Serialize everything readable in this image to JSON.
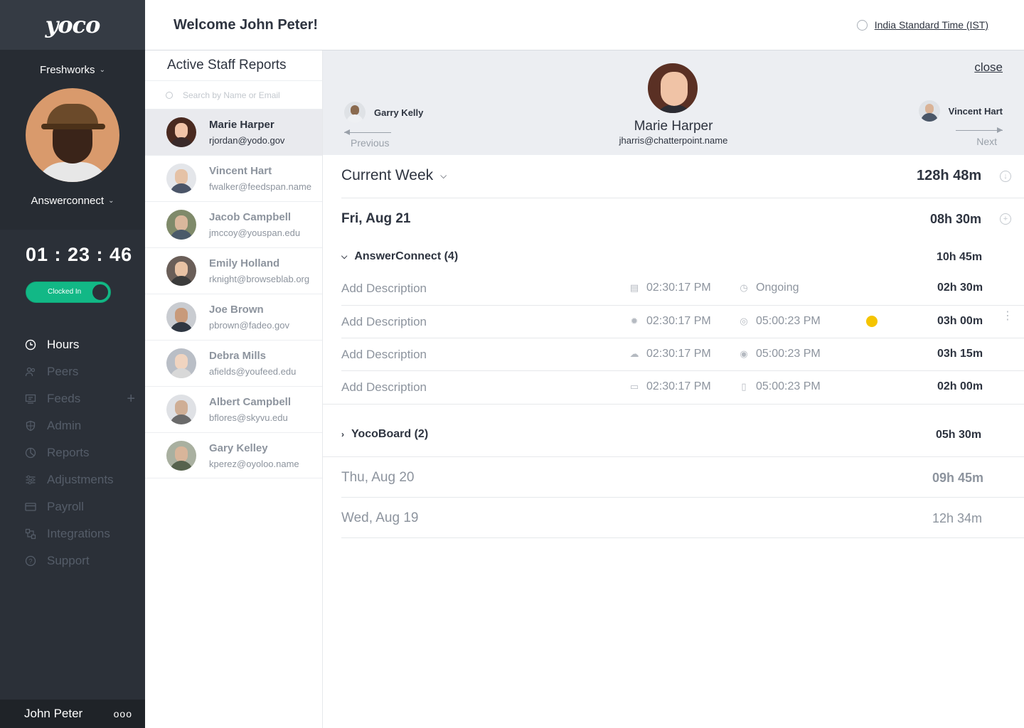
{
  "app": {
    "logo": "yoco"
  },
  "sidebar": {
    "company": "Freshworks",
    "workspace": "Answerconnect",
    "timer": "01 : 23 : 46",
    "toggle_label": "Clocked In",
    "nav": [
      {
        "label": "Hours",
        "icon": "clock-icon",
        "active": true
      },
      {
        "label": "Peers",
        "icon": "people-icon"
      },
      {
        "label": "Feeds",
        "icon": "feed-icon"
      },
      {
        "label": "Admin",
        "icon": "shield-icon"
      },
      {
        "label": "Reports",
        "icon": "pie-chart-icon"
      },
      {
        "label": "Adjustments",
        "icon": "sliders-icon"
      },
      {
        "label": "Payroll",
        "icon": "card-icon"
      },
      {
        "label": "Integrations",
        "icon": "integrations-icon"
      },
      {
        "label": "Support",
        "icon": "help-icon"
      }
    ],
    "user_name": "John Peter",
    "more": "ooo"
  },
  "header": {
    "welcome": "Welcome John Peter!",
    "timezone": "India Standard Time (IST)"
  },
  "staff_panel": {
    "title": "Active Staff Reports",
    "search_placeholder": "Search by Name or Email",
    "staff": [
      {
        "name": "Marie Harper",
        "email": "rjordan@yodo.gov"
      },
      {
        "name": "Vincent Hart",
        "email": "fwalker@feedspan.name"
      },
      {
        "name": "Jacob Campbell",
        "email": "jmccoy@youspan.edu"
      },
      {
        "name": "Emily Holland",
        "email": "rknight@browseblab.org"
      },
      {
        "name": "Joe Brown",
        "email": "pbrown@fadeo.gov"
      },
      {
        "name": "Debra Mills",
        "email": "afields@youfeed.edu"
      },
      {
        "name": "Albert Campbell",
        "email": "bflores@skyvu.edu"
      },
      {
        "name": "Gary Kelley",
        "email": "kperez@oyoloo.name"
      }
    ]
  },
  "detail": {
    "close": "close",
    "prev_name": "Garry Kelly",
    "prev_label": "Previous",
    "next_name": "Vincent Hart",
    "next_label": "Next",
    "name": "Marie Harper",
    "email": "jharris@chatterpoint.name",
    "week_label": "Current Week",
    "week_total": "128h 48m",
    "days": [
      {
        "label": "Fri, Aug 21",
        "total": "08h 30m"
      },
      {
        "label": "Thu, Aug 20",
        "total": "09h 45m"
      },
      {
        "label": "Wed, Aug 19",
        "total": "12h 34m"
      }
    ],
    "projects": [
      {
        "name": "AnswerConnect (4)",
        "total": "10h 45m"
      },
      {
        "name": "YocoBoard (2)",
        "total": "05h 30m"
      }
    ],
    "entries": [
      {
        "desc": "Add Description",
        "start": "02:30:17 PM",
        "end": "Ongoing",
        "dur": "02h 30m"
      },
      {
        "desc": "Add Description",
        "start": "02:30:17 PM",
        "end": "05:00:23 PM",
        "dur": "03h 00m"
      },
      {
        "desc": "Add Description",
        "start": "02:30:17 PM",
        "end": "05:00:23 PM",
        "dur": "03h 15m"
      },
      {
        "desc": "Add Description",
        "start": "02:30:17 PM",
        "end": "05:00:23 PM",
        "dur": "02h 00m"
      }
    ]
  }
}
